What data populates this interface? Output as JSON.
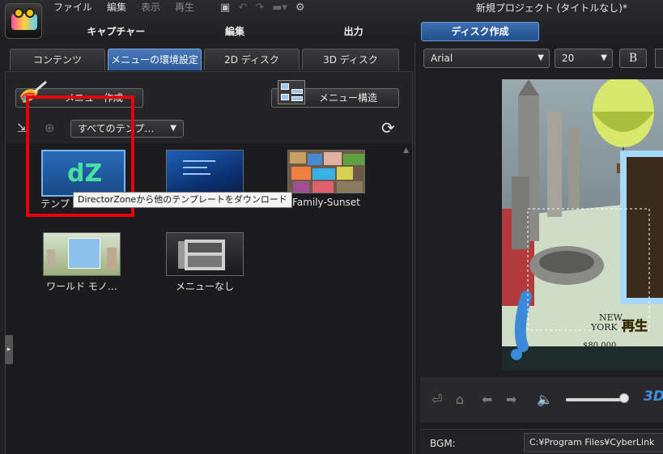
{
  "menubar": {
    "items": [
      "ファイル",
      "編集",
      "表示",
      "再生"
    ],
    "window_title": "新規プロジェクト (タイトルなし)*"
  },
  "mode_tabs": [
    "キャプチャー",
    "編集",
    "出力"
  ],
  "disc_button": "ディスク作成",
  "subtabs": [
    "コンテンツ",
    "メニューの環境設定",
    "2D ディスク",
    "3D ディスク"
  ],
  "toolbar": {
    "create_menu": "メニュー作成",
    "menu_structure": "メニュー構造"
  },
  "filter": {
    "dropdown": "すべてのテンプ…"
  },
  "templates": [
    {
      "label": "テンプ",
      "name": "directorzone"
    },
    {
      "label": "",
      "name": "blue-template"
    },
    {
      "label": "Family-Sunset",
      "name": "family-sunset"
    },
    {
      "label": "ワールド モノ…",
      "name": "world-monopoly"
    },
    {
      "label": "メニューなし",
      "name": "no-menu"
    }
  ],
  "tooltip": "DirectorZoneから他のテンプレートをダウンロード",
  "font_bar": {
    "font": "Arial",
    "size": "20",
    "bold": "B"
  },
  "preview": {
    "play_text": "再生",
    "board_text_1": "NEW",
    "board_text_2": "YORK",
    "board_price": "$80,000"
  },
  "bgm": {
    "label": "BGM:",
    "path": "C:¥Program Files¥CyberLink"
  },
  "colors": {
    "accent": "#2c5b99",
    "highlight": "#e8000e"
  }
}
